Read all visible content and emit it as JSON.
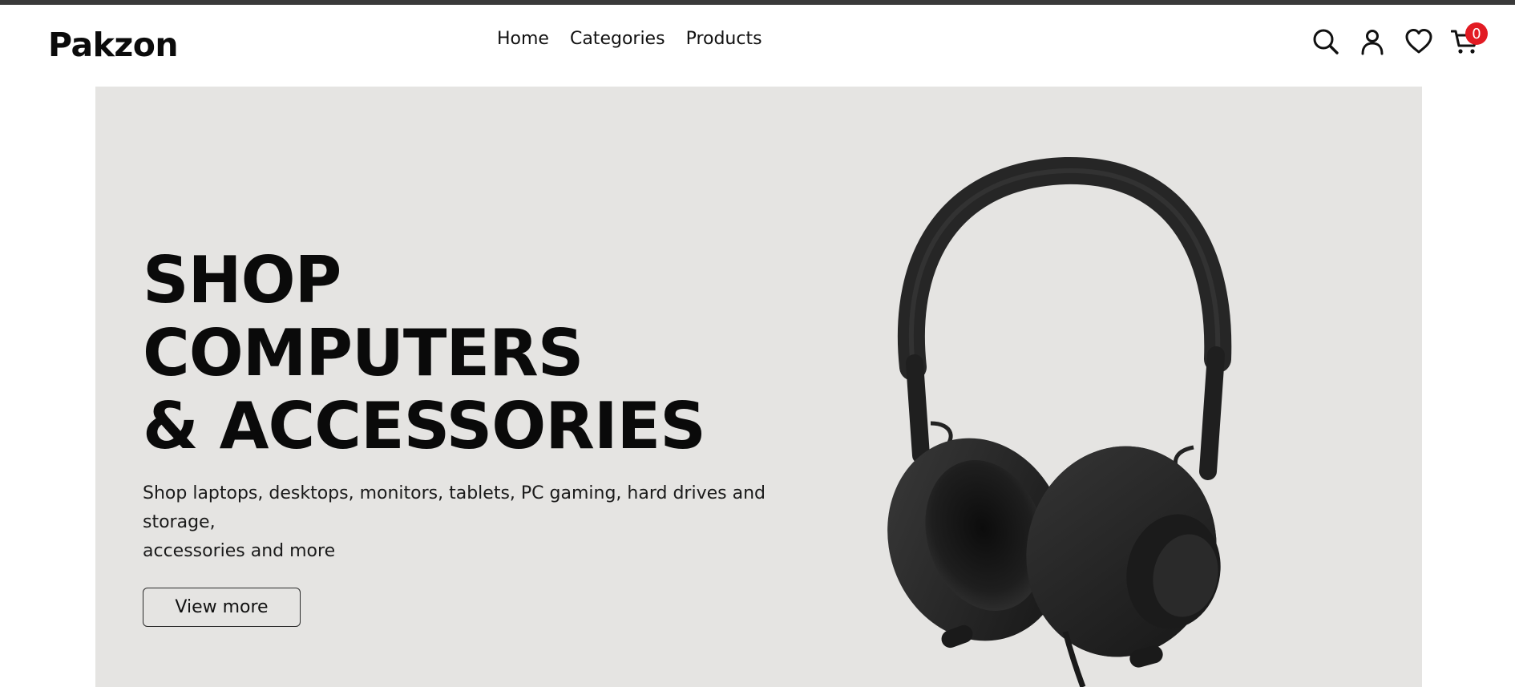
{
  "brand": {
    "name": "Pakzon"
  },
  "nav": {
    "items": [
      {
        "label": "Home"
      },
      {
        "label": "Categories"
      },
      {
        "label": "Products"
      }
    ]
  },
  "header_icons": {
    "search": "search-icon",
    "account": "user-icon",
    "wishlist": "heart-icon",
    "cart": "cart-icon",
    "cart_count": "0"
  },
  "hero": {
    "title_lines": [
      "SHOP",
      "COMPUTERS",
      "& ACCESSORIES"
    ],
    "description_lines": [
      "Shop laptops, desktops, monitors, tablets, PC gaming, hard drives and",
      "storage,",
      "accessories and more"
    ],
    "cta_label": "View more",
    "image": "headphones"
  },
  "colors": {
    "top_bar": "#3a3a3a",
    "hero_background": "#e5e4e2",
    "badge": "#e21b23"
  }
}
